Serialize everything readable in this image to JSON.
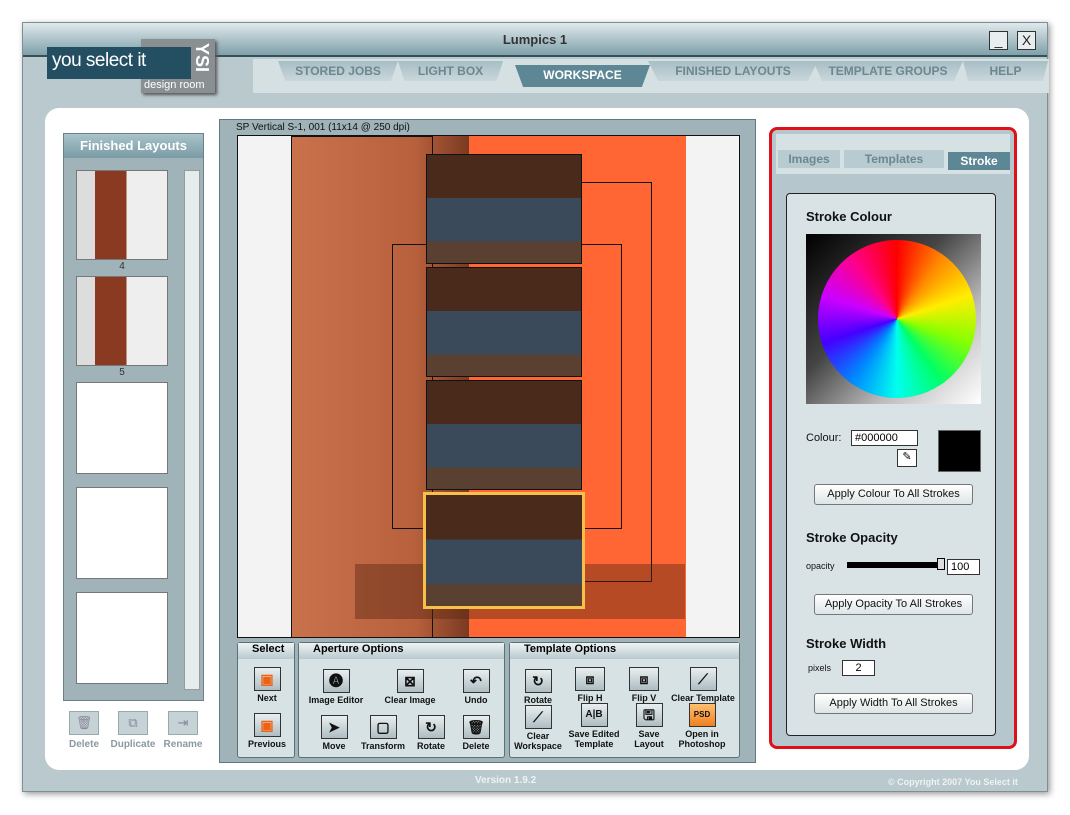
{
  "window": {
    "title": "Lumpics 1",
    "minimize": "_",
    "close": "X"
  },
  "logo": {
    "main": "you select it",
    "ysi": "YSI",
    "sub": "design room"
  },
  "tabs": [
    {
      "label": "STORED JOBS"
    },
    {
      "label": "LIGHT BOX"
    },
    {
      "label": "WORKSPACE",
      "active": true
    },
    {
      "label": "FINISHED LAYOUTS"
    },
    {
      "label": "TEMPLATE GROUPS"
    },
    {
      "label": "HELP"
    }
  ],
  "left": {
    "title": "Finished Layouts",
    "thumbs": [
      {
        "num": "4"
      },
      {
        "num": "5"
      }
    ],
    "buttons": [
      {
        "label": "Delete"
      },
      {
        "label": "Duplicate"
      },
      {
        "label": "Rename"
      }
    ]
  },
  "canvas": {
    "title": "SP Vertical S-1, 001 (11x14 @ 250 dpi)",
    "accent": "#ff6633"
  },
  "select": {
    "title": "Select",
    "next": "Next",
    "previous": "Previous"
  },
  "aperture": {
    "title": "Aperture Options",
    "image_editor": "Image Editor",
    "clear_image": "Clear Image",
    "undo": "Undo",
    "move": "Move",
    "transform": "Transform",
    "rotate": "Rotate",
    "delete": "Delete"
  },
  "template": {
    "title": "Template Options",
    "rotate": "Rotate",
    "flip_h": "Flip H",
    "flip_v": "Flip V",
    "clear_template": "Clear Template",
    "clear_ws1": "Clear",
    "clear_ws2": "Workspace",
    "save_edited1": "Save Edited",
    "save_edited2": "Template",
    "save_layout1": "Save",
    "save_layout2": "Layout",
    "open_ps1": "Open in",
    "open_ps2": "Photoshop",
    "psd": "PSD"
  },
  "right": {
    "tabs": [
      "Images",
      "Templates",
      "Stroke"
    ],
    "stroke_colour": "Stroke Colour",
    "colour_label": "Colour:",
    "colour_value": "#000000",
    "apply_colour": "Apply Colour To All Strokes",
    "stroke_opacity": "Stroke Opacity",
    "opacity_label": "opacity",
    "opacity_value": "100",
    "apply_opacity": "Apply Opacity To All Strokes",
    "stroke_width": "Stroke Width",
    "pixels_label": "pixels",
    "width_value": "2",
    "apply_width": "Apply Width To All Strokes"
  },
  "footer": {
    "version": "Version 1.9.2",
    "copyright": "© Copyright 2007 You Select it"
  }
}
